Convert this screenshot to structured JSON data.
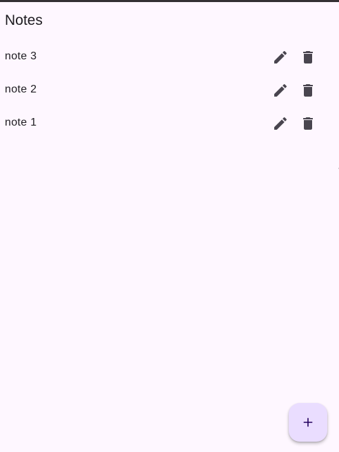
{
  "app_bar": {
    "title": "Notes"
  },
  "notes": [
    {
      "text": "note 3"
    },
    {
      "text": "note 2"
    },
    {
      "text": "note 1"
    }
  ],
  "icons": {
    "edit": "pencil-icon",
    "delete": "trash-icon",
    "add": "plus-icon"
  },
  "colors": {
    "background": "#fef7ff",
    "text": "#1d1b20",
    "icon": "#49454f",
    "fab_background": "#eaddff",
    "fab_icon": "#21005d",
    "status_bar": "#333033"
  }
}
